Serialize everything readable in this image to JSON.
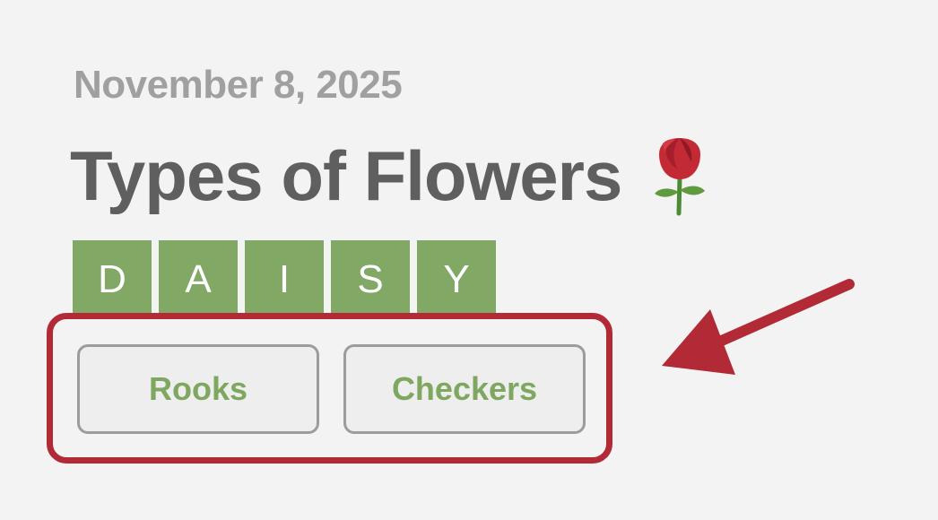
{
  "header": {
    "date": "November 8, 2025",
    "title": "Types of Flowers"
  },
  "answer_tiles": [
    "D",
    "A",
    "I",
    "S",
    "Y"
  ],
  "options": {
    "option_1": "Rooks",
    "option_2": "Checkers"
  },
  "icons": {
    "title_icon": "rose-icon",
    "annotation": "arrow-icon"
  },
  "colors": {
    "tile_green": "#81a864",
    "highlight_red": "#b22a36",
    "option_text": "#7ea760"
  }
}
